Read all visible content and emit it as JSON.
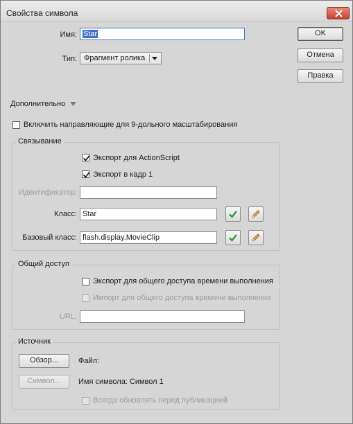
{
  "window": {
    "title": "Свойства символа"
  },
  "name": {
    "label": "Имя:",
    "value": "Star"
  },
  "type": {
    "label": "Тип:",
    "value": "Фрагмент ролика"
  },
  "buttons": {
    "ok": "OK",
    "cancel": "Отмена",
    "edit": "Правка"
  },
  "advanced": {
    "label": "Дополнительно"
  },
  "scale9": {
    "label": "Включить направляющие для 9-дольного масштабирования",
    "checked": false
  },
  "linkage": {
    "title": "Связывание",
    "export_actionscript": {
      "label": "Экспорт для ActionScript",
      "checked": true
    },
    "export_frame1": {
      "label": "Экспорт в кадр 1",
      "checked": true
    },
    "identifier": {
      "label": "Идентификатор:",
      "value": ""
    },
    "class": {
      "label": "Класс:",
      "value": "Star"
    },
    "base_class": {
      "label": "Базовый класс:",
      "value": "flash.display.MovieClip"
    }
  },
  "sharing": {
    "title": "Общий доступ",
    "export_runtime": {
      "label": "Экспорт для общего доступа времени выполнения",
      "checked": false
    },
    "import_runtime": {
      "label": "Импорт для общего доступа времени выполнения",
      "checked": false
    },
    "url": {
      "label": "URL:",
      "value": ""
    }
  },
  "source": {
    "title": "Источник",
    "browse_button": "Обзор...",
    "file_label": "Файл:",
    "symbol_button": "Символ...",
    "symbol_name": "Имя символа: Символ 1",
    "always_update": {
      "label": "Всегда обновлять перед публикацией",
      "checked": false
    }
  }
}
